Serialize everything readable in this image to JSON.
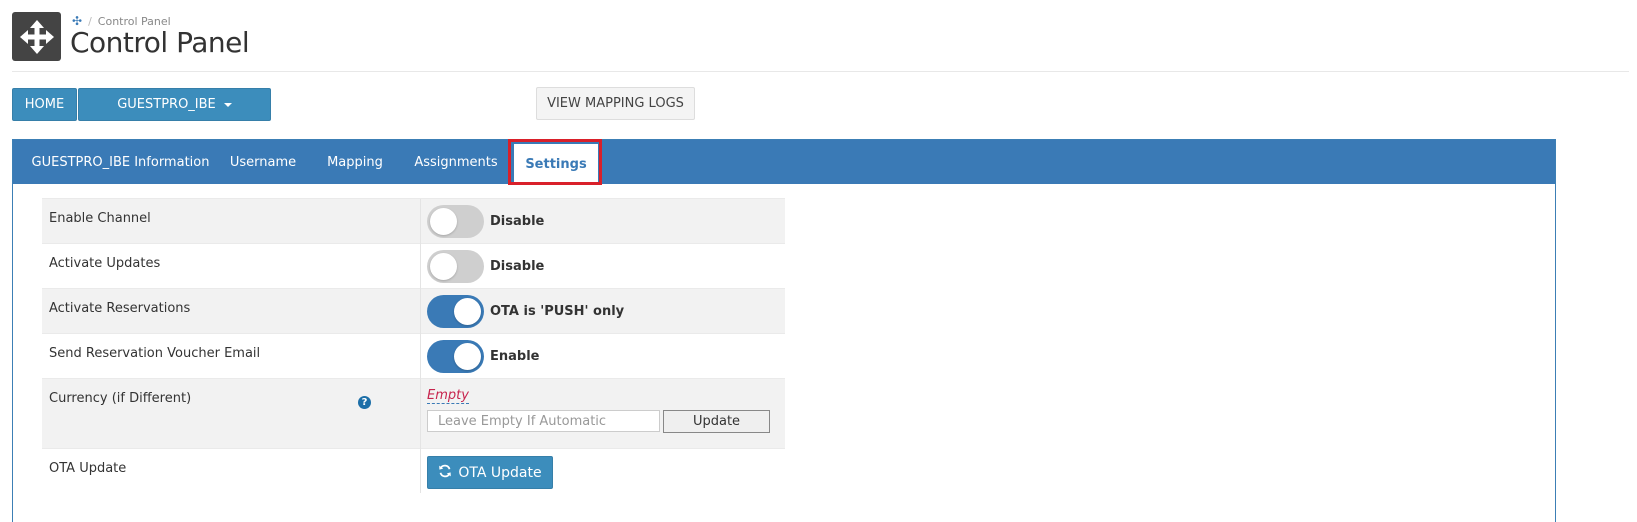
{
  "header": {
    "breadcrumb": "Control Panel",
    "title": "Control Panel",
    "app_icon": "move-arrows-icon"
  },
  "toolbar": {
    "home_label": "HOME",
    "channel_label": "GUESTPRO_IBE",
    "mapping_logs_label": "VIEW MAPPING LOGS"
  },
  "tabs": [
    {
      "label": "GUESTPRO_IBE Information"
    },
    {
      "label": "Username"
    },
    {
      "label": "Mapping"
    },
    {
      "label": "Assignments"
    },
    {
      "label": "Settings",
      "active": true
    }
  ],
  "settings": {
    "enable_channel": {
      "label": "Enable Channel",
      "state": "off",
      "value": "Disable"
    },
    "activate_updates": {
      "label": "Activate Updates",
      "state": "off",
      "value": "Disable"
    },
    "activate_reservations": {
      "label": "Activate Reservations",
      "state": "on",
      "value": "OTA is 'PUSH' only"
    },
    "send_voucher": {
      "label": "Send Reservation Voucher Email",
      "state": "on",
      "value": "Enable"
    },
    "currency": {
      "label": "Currency (if Different)",
      "current": "Empty",
      "placeholder": "Leave Empty If Automatic",
      "update_label": "Update"
    },
    "ota_update": {
      "label": "OTA Update",
      "button_label": "OTA Update"
    }
  },
  "colors": {
    "primary": "#3c8dbc",
    "tabbar": "#3a7ab6",
    "highlight": "#d9202a",
    "empty_text": "#c7254e"
  }
}
